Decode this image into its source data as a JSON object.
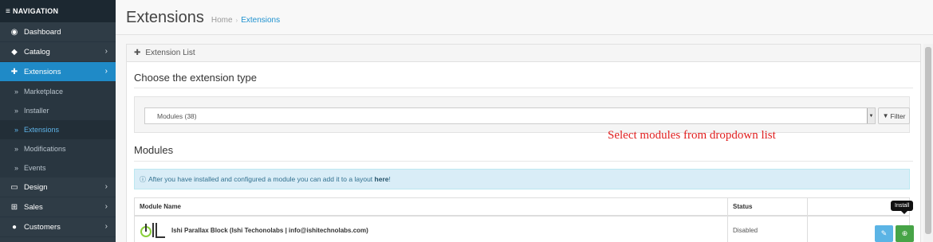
{
  "sidebar": {
    "heading": "NAVIGATION",
    "items": [
      {
        "label": "Dashboard",
        "icon": "dashboard-icon"
      },
      {
        "label": "Catalog",
        "icon": "tag-icon"
      },
      {
        "label": "Extensions",
        "icon": "puzzle-icon"
      },
      {
        "label": "Design",
        "icon": "monitor-icon"
      },
      {
        "label": "Sales",
        "icon": "cart-icon"
      },
      {
        "label": "Customers",
        "icon": "user-icon"
      }
    ],
    "sub_items": [
      "Marketplace",
      "Installer",
      "Extensions",
      "Modifications",
      "Events"
    ]
  },
  "header": {
    "title": "Extensions",
    "breadcrumb": [
      "Home",
      "Extensions"
    ]
  },
  "panel": {
    "heading": "Extension List",
    "choose_title": "Choose the extension type",
    "select_value": "Modules (38)",
    "filter_label": "Filter",
    "modules_title": "Modules",
    "annotation": "Select modules from dropdown list",
    "alert_text": "After you have installed and configured a module you can add it to a layout",
    "alert_link": "here",
    "alert_tail": "!"
  },
  "table": {
    "columns": [
      "Module Name",
      "Status",
      ""
    ],
    "rows": [
      {
        "name": "Ishi Parallax Block (Ishi Techonolabs | info@ishitechnolabs.com)",
        "status": "Disabled"
      }
    ],
    "tooltip": "Install"
  },
  "colors": {
    "accent": "#1e91cf",
    "sidebar": "#2f3c46",
    "install": "#47a447",
    "edit": "#5bb4e5",
    "annotation": "#e02020"
  }
}
